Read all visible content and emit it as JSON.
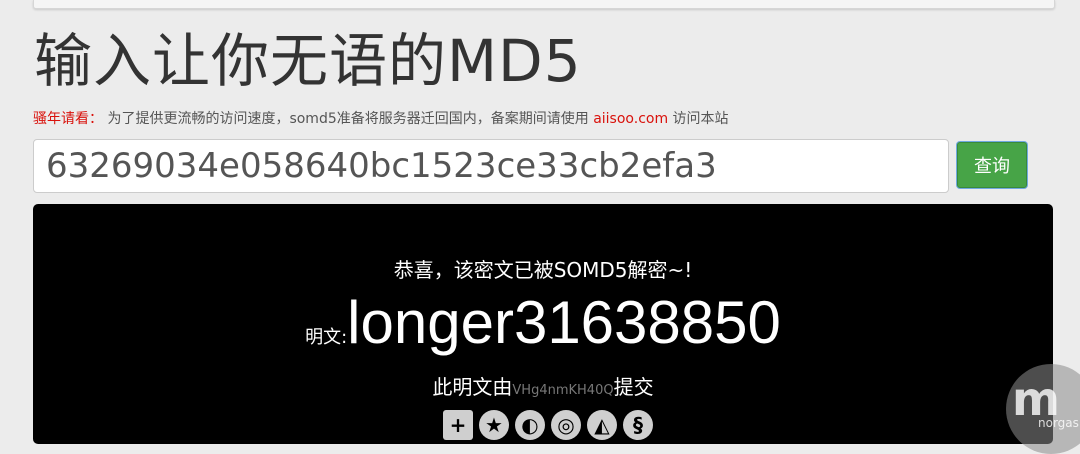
{
  "page": {
    "title": "输入让你无语的MD5"
  },
  "notice": {
    "label": "骚年请看：",
    "text": "为了提供更流畅的访问速度，somd5准备将服务器迁回国内，备案期间请使用",
    "link": "aiisoo.com",
    "suffix": "访问本站"
  },
  "search": {
    "value": "63269034e058640bc1523ce33cb2efa3",
    "button_label": "查询"
  },
  "result": {
    "congrats": "恭喜，该密文已被SOMD5解密~!",
    "plaintext_label": "明文:",
    "plaintext_value": "longer31638850",
    "submit_prefix": "此明文由",
    "submitter": "VHg4nmKH40Q",
    "submit_suffix": "提交"
  },
  "share": {
    "icons": [
      "plus-square-icon",
      "star-icon",
      "weibo-icon",
      "qzone-icon",
      "tencent-icon",
      "renren-icon"
    ]
  },
  "watermark": {
    "letters": "m",
    "small_text": "norgas"
  }
}
